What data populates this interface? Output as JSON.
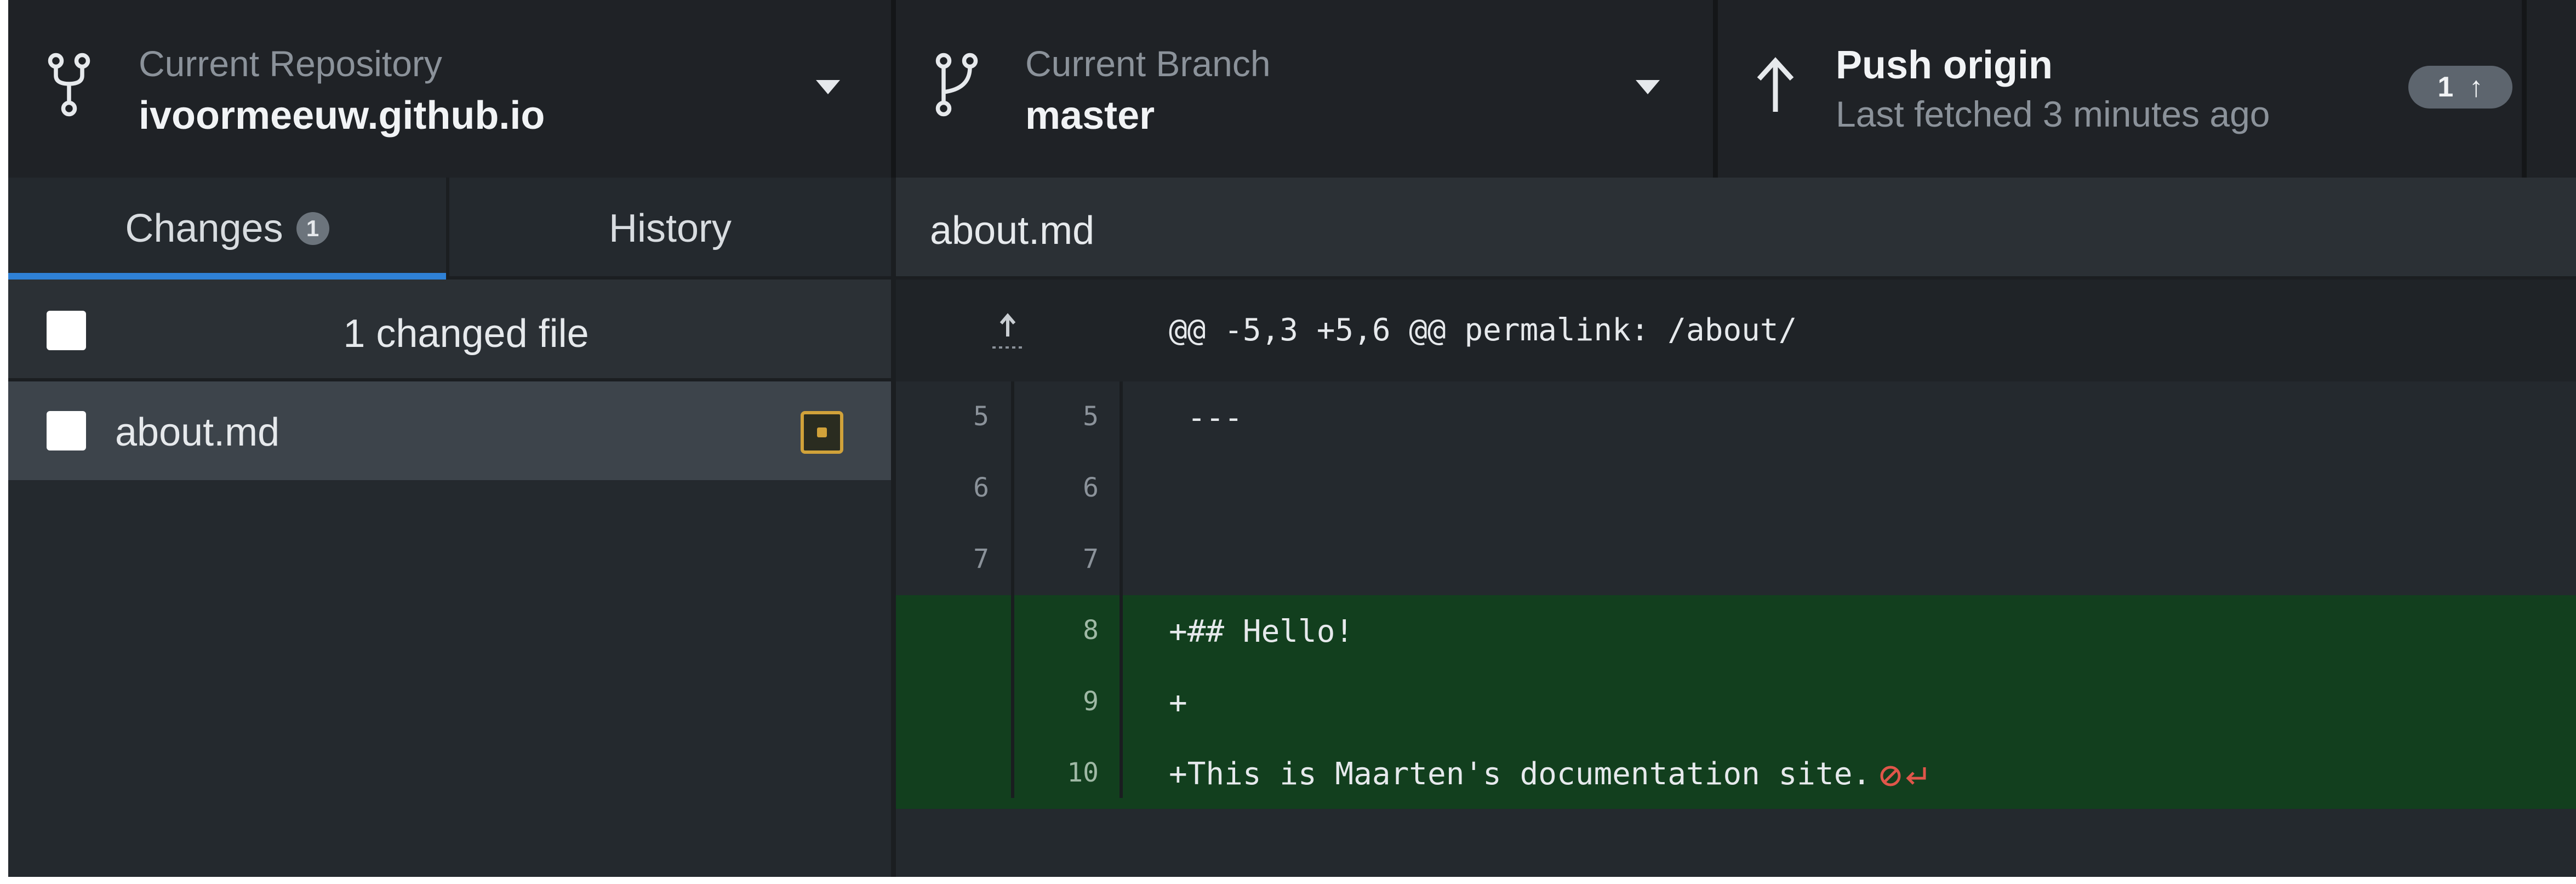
{
  "toolbar": {
    "repository": {
      "title": "Current Repository",
      "value": "ivoormeeuw.github.io",
      "icon": "repo-icon"
    },
    "branch": {
      "title": "Current Branch",
      "value": "master",
      "icon": "branch-icon"
    },
    "push": {
      "title": "Push origin",
      "subtitle": "Last fetched 3 minutes ago",
      "badge_count": "1",
      "badge_arrow": "↑",
      "icon": "arrow-up-icon"
    }
  },
  "sidebar": {
    "tabs": [
      {
        "label": "Changes",
        "count": "1",
        "active": true
      },
      {
        "label": "History",
        "active": false
      }
    ],
    "changed_summary": "1 changed file",
    "files": [
      {
        "name": "about.md",
        "status": "modified"
      }
    ]
  },
  "diff": {
    "filename": "about.md",
    "hunk_header": "@@ -5,3 +5,6 @@ permalink: /about/",
    "lines": [
      {
        "old": "5",
        "new": "5",
        "text": " ---",
        "type": "context"
      },
      {
        "old": "6",
        "new": "6",
        "text": "",
        "type": "context"
      },
      {
        "old": "7",
        "new": "7",
        "text": "",
        "type": "context"
      },
      {
        "old": "",
        "new": "8",
        "text": "+## Hello!",
        "type": "add"
      },
      {
        "old": "",
        "new": "9",
        "text": "+",
        "type": "add"
      },
      {
        "old": "",
        "new": "10",
        "text": "+This is Maarten's documentation site.",
        "type": "add"
      }
    ]
  },
  "colors": {
    "accent": "#2f81d6",
    "added_background": "#123f1e",
    "modified": "#d1a23a",
    "no_newline_marker": "#e0564a"
  }
}
